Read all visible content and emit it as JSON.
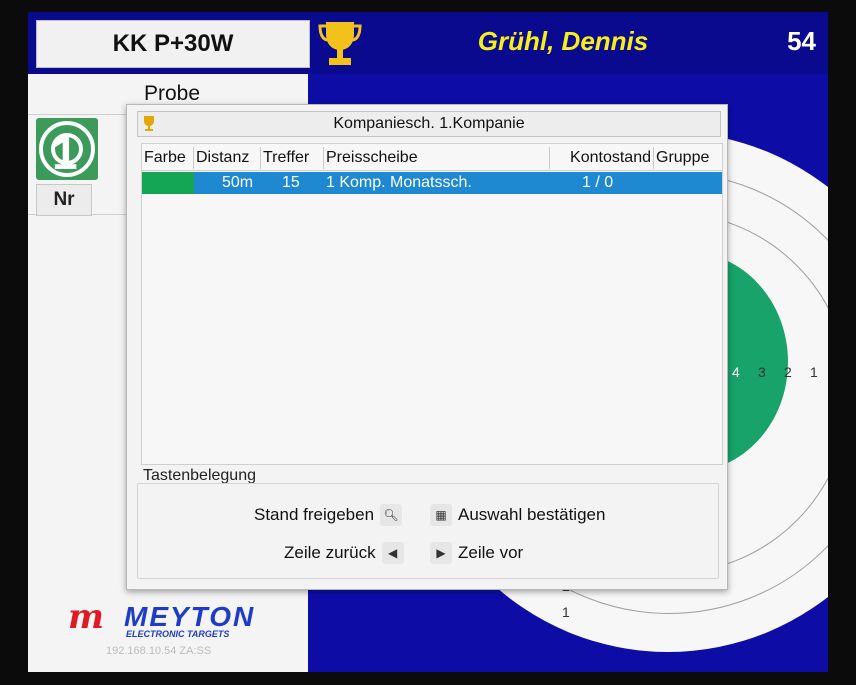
{
  "header": {
    "discipline": "KK P+30W",
    "shooter_name": "Grühl, Dennis",
    "stand_number": "54"
  },
  "left_panel": {
    "mode_label": "Probe",
    "mini_target_number": "1",
    "nr_header": "Nr"
  },
  "target": {
    "ring_numbers": [
      "4",
      "3",
      "2",
      "1"
    ],
    "lower_numbers": [
      "2",
      "1"
    ]
  },
  "dialog": {
    "group_title": "Kompaniesch. 1.Kompanie",
    "columns": [
      "Farbe",
      "Distanz",
      "Treffer",
      "Preisscheibe",
      "Kontostand",
      "Gruppe"
    ],
    "rows": [
      {
        "farbe": "#14a655",
        "distanz": "50m",
        "treffer": "15",
        "preisscheibe": "1 Komp. Monatssch.",
        "kontostand": "1 / 0",
        "gruppe": ""
      }
    ],
    "keys_title": "Tastenbelegung",
    "keys": {
      "stand_freigeben": "Stand freigeben",
      "auswahl_bestaetigen": "Auswahl bestätigen",
      "zeile_zurueck": "Zeile zurück",
      "zeile_vor": "Zeile vor"
    }
  },
  "branding": {
    "logo_letter": "m",
    "logo_name": "MEYTON",
    "logo_tagline": "ELECTRONIC TARGETS",
    "ip_address": "192.168.10.54 ZA:SS"
  },
  "colors": {
    "background_blue": "#0d0da6",
    "name_yellow": "#f6ef1a",
    "selection_blue": "#1e88d0",
    "target_green": "#18a36a",
    "logo_red": "#e01a22",
    "logo_blue": "#1f3cc8"
  }
}
